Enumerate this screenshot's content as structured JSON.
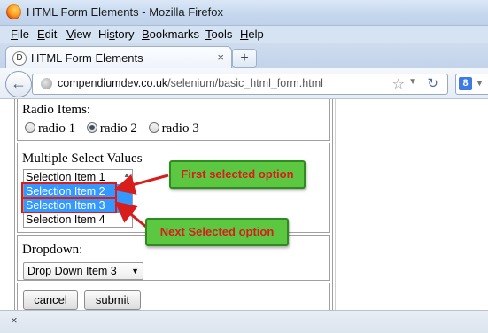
{
  "window": {
    "title": "HTML Form Elements - Mozilla Firefox"
  },
  "menu": [
    "File",
    "Edit",
    "View",
    "History",
    "Bookmarks",
    "Tools",
    "Help"
  ],
  "menu_underline": [
    "F",
    "E",
    "V",
    "s",
    "B",
    "T",
    "H"
  ],
  "tab": {
    "label": "HTML Form Elements",
    "close": "×",
    "new_tab": "+"
  },
  "navbar": {
    "url_host": "compendiumdev.co.uk",
    "url_path": "/selenium/basic_html_form.html",
    "search_engine": "8"
  },
  "form": {
    "radio_label": "Radio Items:",
    "radios": [
      {
        "label": "radio 1",
        "checked": false
      },
      {
        "label": "radio 2",
        "checked": true
      },
      {
        "label": "radio 3",
        "checked": false
      }
    ],
    "multi_label": "Multiple Select Values",
    "multi_options": [
      {
        "label": "Selection Item 1",
        "selected": false
      },
      {
        "label": "Selection Item 2",
        "selected": true
      },
      {
        "label": "Selection Item 3",
        "selected": true
      },
      {
        "label": "Selection Item 4",
        "selected": false
      }
    ],
    "dropdown_label": "Dropdown:",
    "dropdown_value": "Drop Down Item 3",
    "cancel_label": "cancel",
    "submit_label": "submit"
  },
  "annotations": {
    "first": "First selected option",
    "next": "Next Selected option",
    "color": "#d81d1d",
    "box_color": "#5cc842"
  },
  "status": {
    "close": "×"
  }
}
